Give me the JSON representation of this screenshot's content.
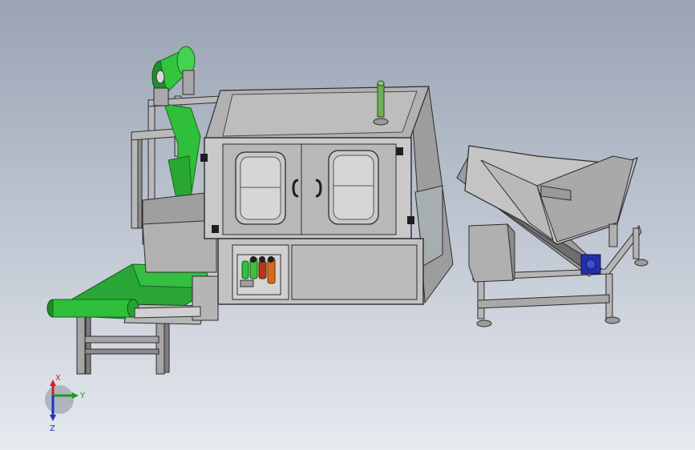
{
  "viewport": {
    "background_top": "#99a3b3",
    "background_bottom": "#e7eaef"
  },
  "colors": {
    "steel_light": "#c4c4c4",
    "steel_mid": "#a9a9a9",
    "steel_dark": "#6e6e6e",
    "panel_grey": "#b3b3b3",
    "conveyor_green": "#2fbf3a",
    "frame_outline": "#2c2c2c",
    "motor_blue": "#2230a8",
    "valve_orange": "#d86a1a"
  },
  "model": {
    "machines": [
      "infeed-belt-conveyor",
      "film-roll-unwinder",
      "main-enclosure-cabinet",
      "pneumatic-control-panel",
      "inclined-hopper-conveyor"
    ],
    "signal_tower_color": "#6fae5b"
  },
  "triad": {
    "x_label": "X",
    "y_label": "Y",
    "z_label": "Z",
    "x_color": "#d42020",
    "y_color": "#1f9a1f",
    "z_color": "#2030c0"
  }
}
